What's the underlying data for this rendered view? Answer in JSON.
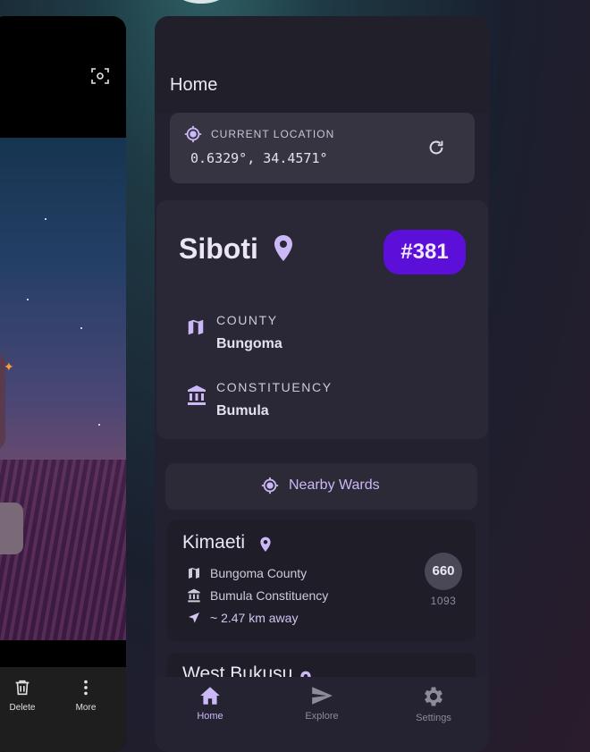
{
  "app": {
    "title": "Home"
  },
  "current_location": {
    "label": "CURRENT LOCATION",
    "coords": "0.6329°, 34.4571°",
    "refresh_icon": "refresh-icon"
  },
  "ward": {
    "name": "Siboti",
    "badge": "#381",
    "county_label": "COUNTY",
    "county_value": "Bungoma",
    "constituency_label": "CONSTITUENCY",
    "constituency_value": "Bumula"
  },
  "nearby_button": {
    "label": "Nearby Wards"
  },
  "nearby_list": [
    {
      "name": "Kimaeti",
      "county": "Bungoma County",
      "constituency": "Bumula Constituency",
      "distance": "~ 2.47 km away",
      "rank": "660",
      "sub": "1093"
    },
    {
      "name": "West Bukusu"
    }
  ],
  "bottom_nav": [
    {
      "label": "Home",
      "icon": "home-icon",
      "active": true
    },
    {
      "label": "Explore",
      "icon": "send-icon",
      "active": false
    },
    {
      "label": "Settings",
      "icon": "gear-icon",
      "active": false
    }
  ],
  "left_app": {
    "actions": [
      {
        "label": "Delete",
        "icon": "trash-icon"
      },
      {
        "label": "More",
        "icon": "more-vert-icon"
      }
    ]
  },
  "colors": {
    "accent": "#cbb8f6",
    "badge": "#5b0fd8",
    "surface": "#232130"
  }
}
